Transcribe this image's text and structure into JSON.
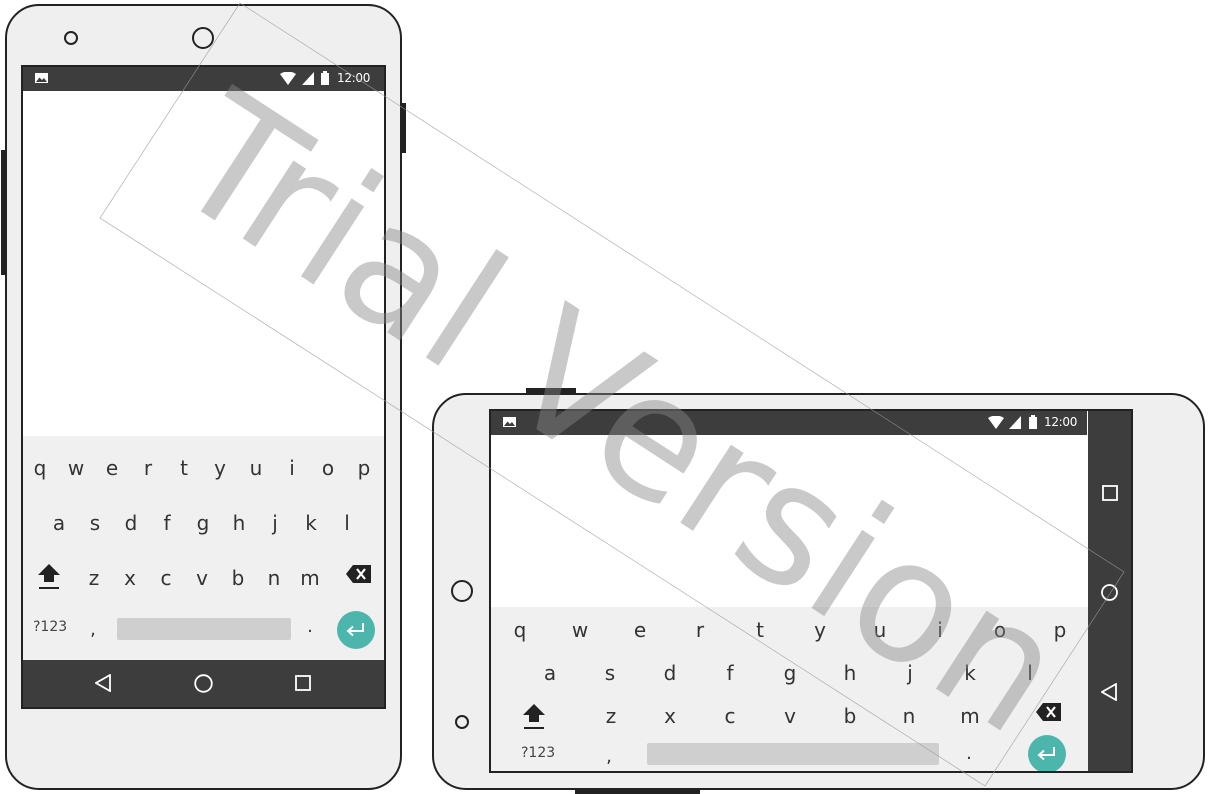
{
  "status_bar": {
    "time": "12:00"
  },
  "keyboard": {
    "row1": [
      "q",
      "w",
      "e",
      "r",
      "t",
      "y",
      "u",
      "i",
      "o",
      "p"
    ],
    "row2": [
      "a",
      "s",
      "d",
      "f",
      "g",
      "h",
      "j",
      "k",
      "l"
    ],
    "row3": [
      "z",
      "x",
      "c",
      "v",
      "b",
      "n",
      "m"
    ],
    "symbols_label": "?123",
    "comma": ",",
    "period": "."
  },
  "watermark": {
    "text": "Trial Version"
  },
  "colors": {
    "accent": "#4db6ac",
    "bar": "#3d3d3d",
    "frame": "#efefef"
  }
}
